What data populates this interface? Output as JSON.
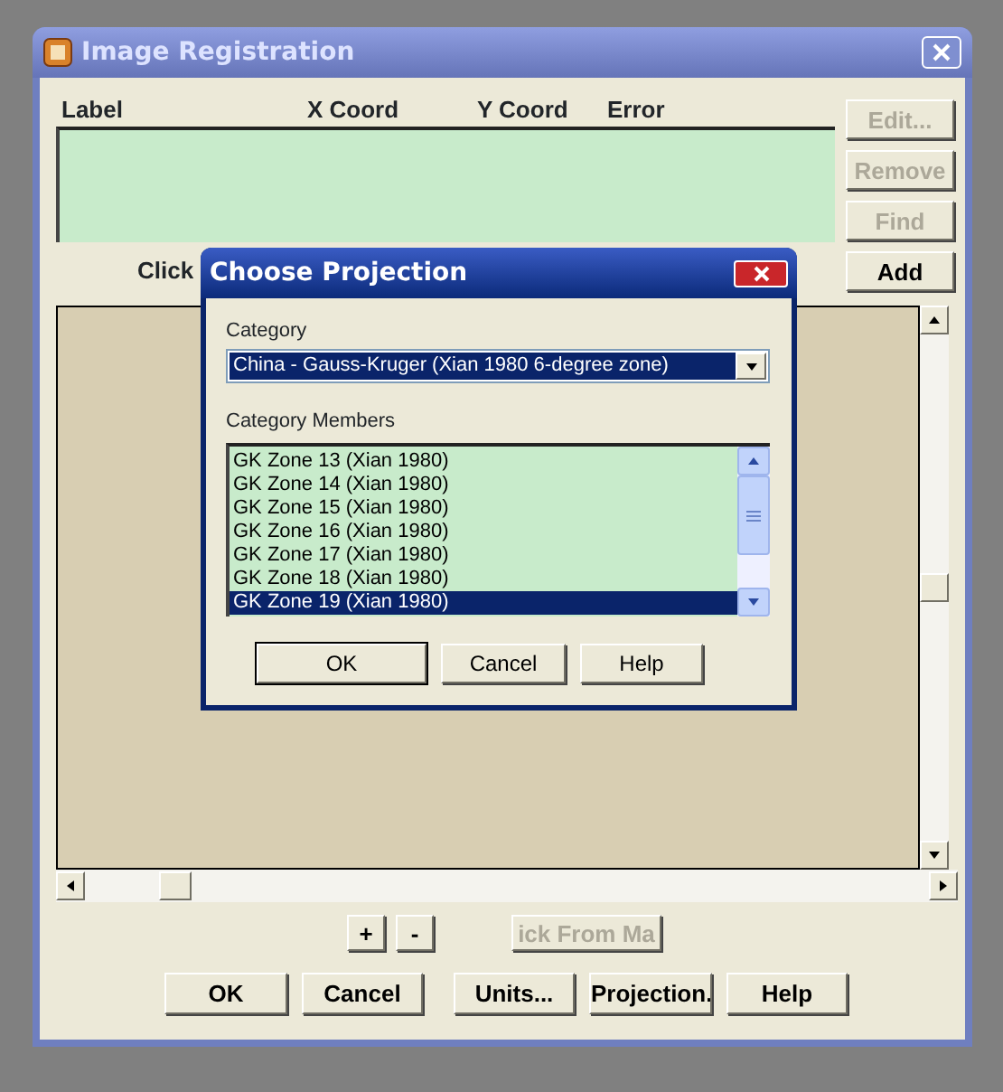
{
  "window": {
    "title": "Image Registration"
  },
  "point_list": {
    "columns": [
      "Label",
      "X Coord",
      "Y Coord",
      "Error"
    ]
  },
  "side_buttons": [
    {
      "label": "Edit...",
      "disabled": true
    },
    {
      "label": "Remove",
      "disabled": true
    },
    {
      "label": "Find",
      "disabled": true
    },
    {
      "label": "Add",
      "disabled": false
    }
  ],
  "hint": "Click",
  "zoom_buttons": [
    {
      "label": "+",
      "disabled": false
    },
    {
      "label": "-",
      "disabled": false
    },
    {
      "label": "ick From Ma",
      "disabled": true
    }
  ],
  "buttons": [
    {
      "label": "OK"
    },
    {
      "label": "Cancel"
    },
    {
      "label": "Units..."
    },
    {
      "label": "Projection."
    },
    {
      "label": "Help"
    }
  ],
  "dialog": {
    "title": "Choose Projection",
    "category_label": "Category",
    "category_value": "China - Gauss-Kruger (Xian 1980 6-degree zone)",
    "members_label": "Category Members",
    "members": [
      {
        "label": "GK Zone 13 (Xian 1980)",
        "selected": false
      },
      {
        "label": "GK Zone 14 (Xian 1980)",
        "selected": false
      },
      {
        "label": "GK Zone 15 (Xian 1980)",
        "selected": false
      },
      {
        "label": "GK Zone 16 (Xian 1980)",
        "selected": false
      },
      {
        "label": "GK Zone 17 (Xian 1980)",
        "selected": false
      },
      {
        "label": "GK Zone 18 (Xian 1980)",
        "selected": false
      },
      {
        "label": "GK Zone 19 (Xian 1980)",
        "selected": true
      }
    ],
    "buttons": [
      {
        "label": "OK",
        "default": true
      },
      {
        "label": "Cancel",
        "default": false
      },
      {
        "label": "Help",
        "default": false
      }
    ]
  }
}
